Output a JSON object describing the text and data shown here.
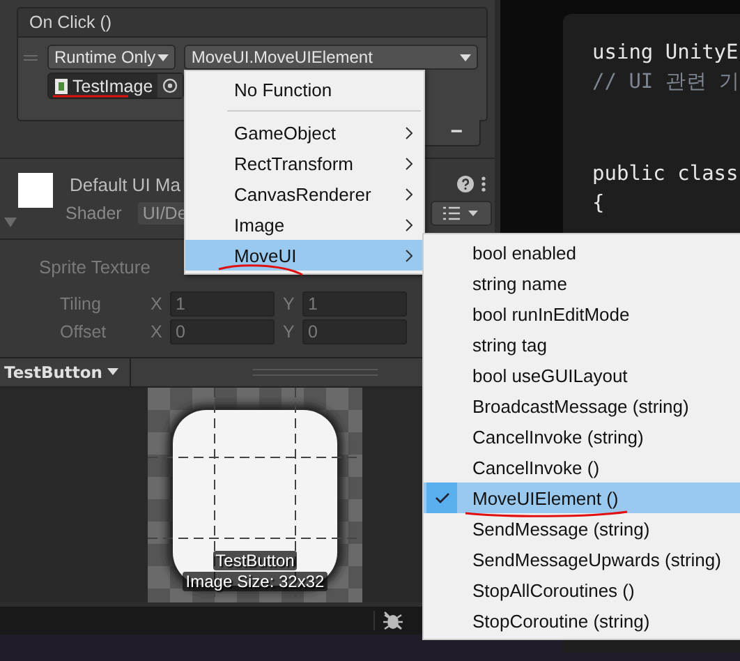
{
  "event": {
    "title": "On Click ()",
    "mode": "Runtime Only",
    "function": "MoveUI.MoveUIElement",
    "target": "TestImage",
    "remove": "−"
  },
  "material": {
    "name": "Default UI Ma",
    "shader_label": "Shader",
    "shader": "UI/De"
  },
  "sprite": {
    "label": "Sprite Texture",
    "disabled": true,
    "rows": [
      {
        "label": "Tiling",
        "fields": [
          {
            "axis": "X",
            "value": "1"
          },
          {
            "axis": "Y",
            "value": "1"
          }
        ]
      },
      {
        "label": "Offset",
        "fields": [
          {
            "axis": "X",
            "value": "0"
          },
          {
            "axis": "Y",
            "value": "0"
          }
        ]
      }
    ]
  },
  "preview": {
    "title": "TestButton",
    "name": "TestButton",
    "size": "Image Size: 32x32"
  },
  "code": {
    "blocks": [
      {
        "lines": [
          {
            "text": "using UnityE",
            "kind": "code"
          },
          {
            "text": "// UI 관련 기",
            "kind": "comment"
          }
        ]
      },
      {
        "lines": [
          {
            "text": "public class",
            "kind": "code"
          },
          {
            "text": "{",
            "kind": "code"
          }
        ]
      }
    ]
  },
  "menu": {
    "items": [
      {
        "kind": "item",
        "label": "No Function",
        "submenu": false,
        "selected": false
      },
      {
        "kind": "separator"
      },
      {
        "kind": "item",
        "label": "GameObject",
        "submenu": true,
        "selected": false
      },
      {
        "kind": "item",
        "label": "RectTransform",
        "submenu": true,
        "selected": false
      },
      {
        "kind": "item",
        "label": "CanvasRenderer",
        "submenu": true,
        "selected": false
      },
      {
        "kind": "item",
        "label": "Image",
        "submenu": true,
        "selected": false
      },
      {
        "kind": "item",
        "label": "MoveUI",
        "submenu": true,
        "selected": true
      }
    ]
  },
  "submenu": {
    "items": [
      {
        "label": "bool enabled",
        "selected": false
      },
      {
        "label": "string name",
        "selected": false
      },
      {
        "label": "bool runInEditMode",
        "selected": false
      },
      {
        "label": "string tag",
        "selected": false
      },
      {
        "label": "bool useGUILayout",
        "selected": false
      },
      {
        "label": "BroadcastMessage (string)",
        "selected": false
      },
      {
        "label": "CancelInvoke (string)",
        "selected": false
      },
      {
        "label": "CancelInvoke ()",
        "selected": false
      },
      {
        "label": "MoveUIElement ()",
        "selected": true
      },
      {
        "label": "SendMessage (string)",
        "selected": false
      },
      {
        "label": "SendMessageUpwards (string)",
        "selected": false
      },
      {
        "label": "StopAllCoroutines ()",
        "selected": false
      },
      {
        "label": "StopCoroutine (string)",
        "selected": false
      }
    ]
  }
}
